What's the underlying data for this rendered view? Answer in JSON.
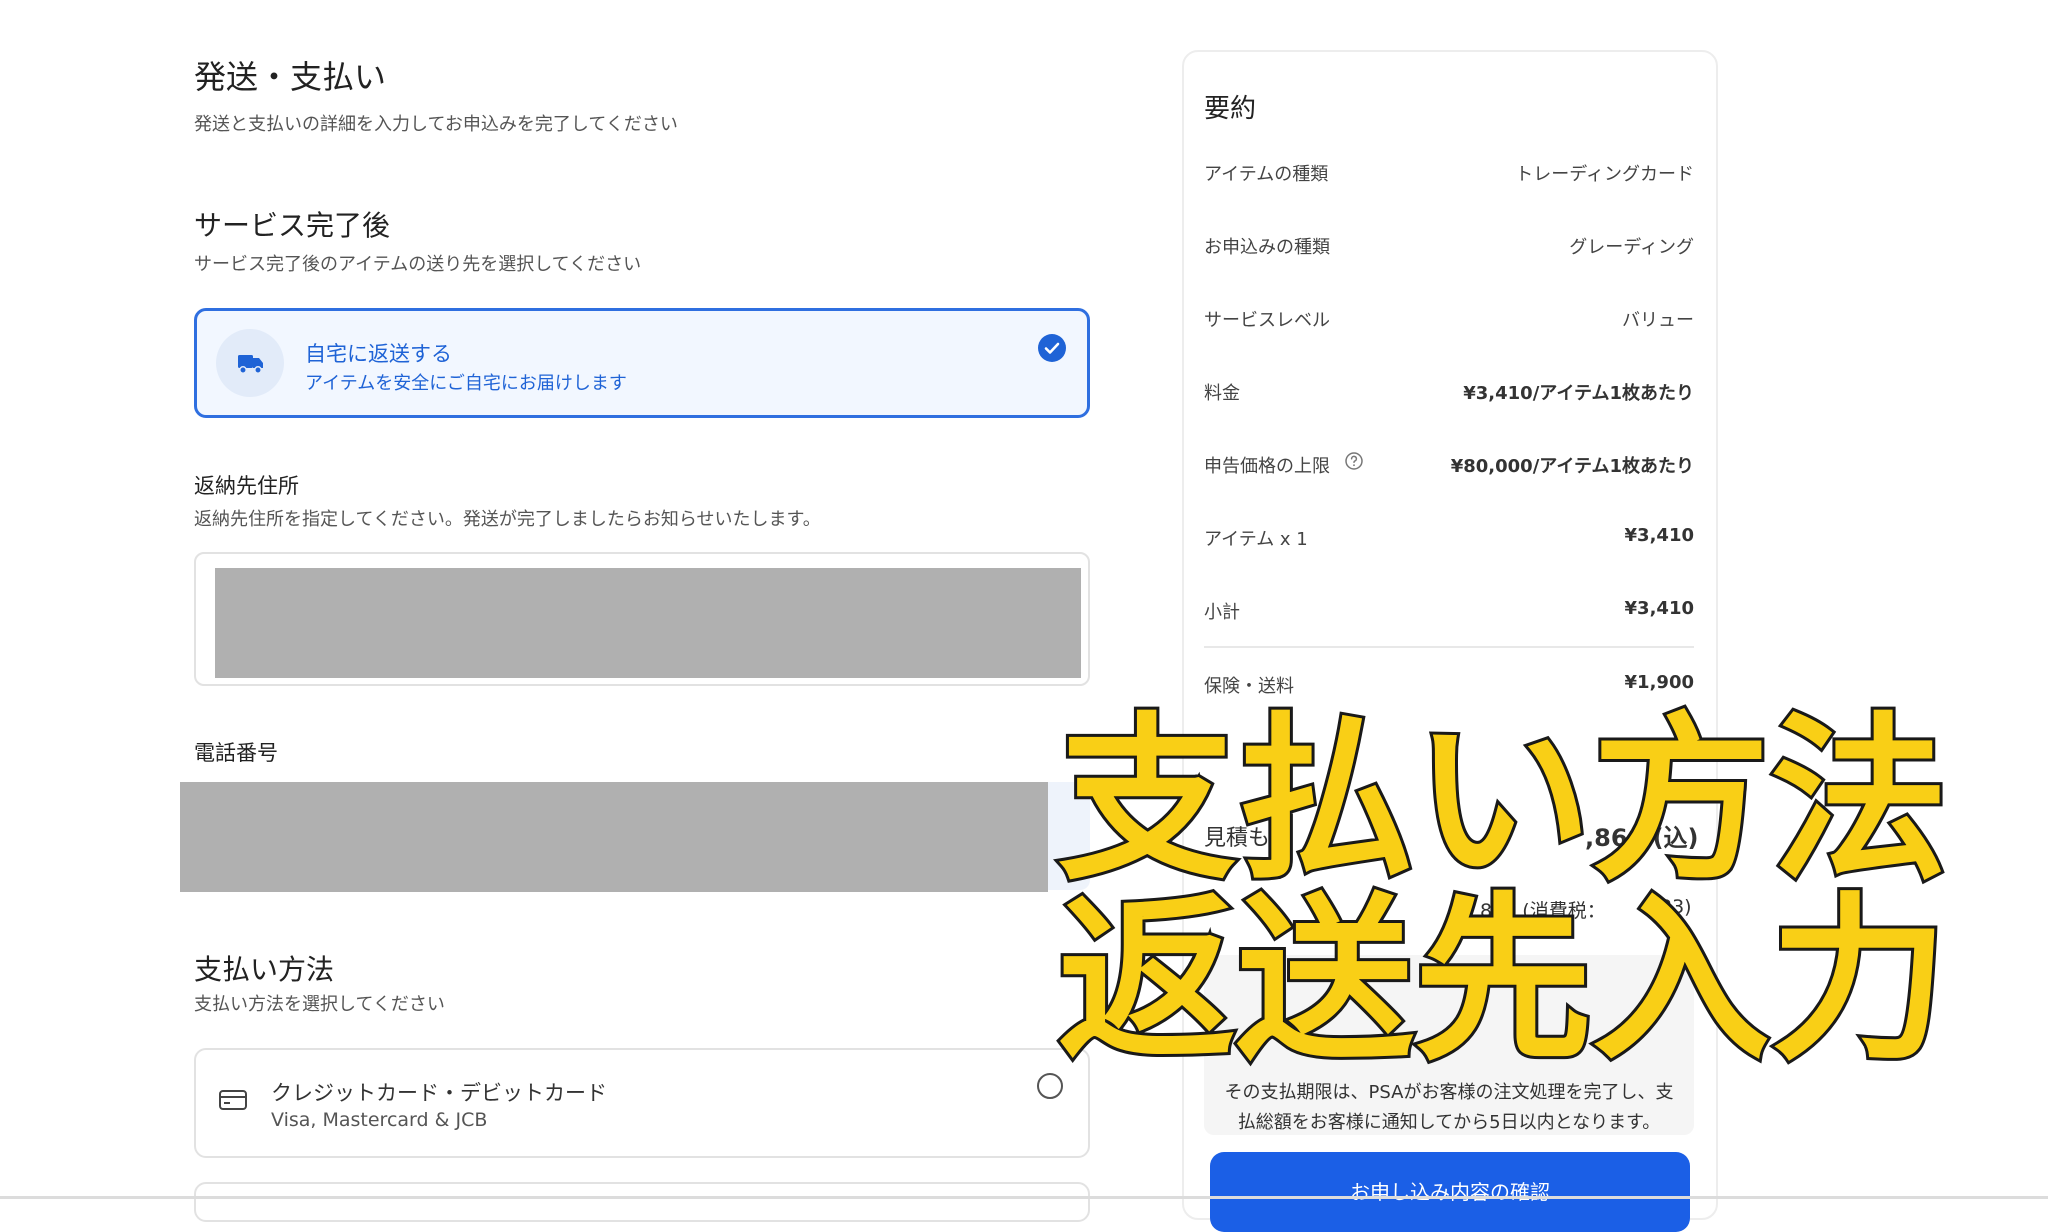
{
  "page": {
    "title": "発送・支払い",
    "subtitle": "発送と支払いの詳細を入力してお申込みを完了してください"
  },
  "after_service": {
    "heading": "サービス完了後",
    "subheading": "サービス完了後のアイテムの送り先を選択してください",
    "option": {
      "title": "自宅に返送する",
      "subtitle": "アイテムを安全にご自宅にお届けします",
      "icon": "truck-icon",
      "selected": true
    }
  },
  "return_address": {
    "heading": "返納先住所",
    "subheading": "返納先住所を指定してください。発送が完了しましたらお知らせいたします。"
  },
  "phone": {
    "heading": "電話番号"
  },
  "payment": {
    "heading": "支払い方法",
    "subheading": "支払い方法を選択してください",
    "option": {
      "title": "クレジットカード・デビットカード",
      "subtitle": "Visa, Mastercard & JCB",
      "icon": "credit-card-icon",
      "selected": false
    }
  },
  "summary": {
    "heading": "要約",
    "rows": [
      {
        "label": "アイテムの種類",
        "value": "トレーディングカード"
      },
      {
        "label": "お申込みの種類",
        "value": "グレーディング"
      },
      {
        "label": "サービスレベル",
        "value": "バリュー"
      },
      {
        "label": "料金",
        "value": "¥3,410/アイテム1枚あたり"
      },
      {
        "label": "申告価格の上限",
        "value": "¥80,000/アイテム1枚あたり"
      },
      {
        "label": "アイテム x 1",
        "value": "¥3,410"
      },
      {
        "label": "小計",
        "value": "¥3,410"
      },
      {
        "label": "保険・送料",
        "value": "¥1,900"
      }
    ],
    "estimate_label_fragment": "見積も",
    "estimate_value_fragment": ",860 (込)",
    "tax_value_fragment": "860 (消費税：",
    "tax_value_end": "33)",
    "notice_lines": [
      "その支払期限は、PSAがお客様の注文処理を完了し、支",
      "払総額をお客様に通知してから5日以内となります。"
    ],
    "confirm_button": "お申し込み内容の確認"
  },
  "overlay": {
    "line1": "支払い方法",
    "line2": "返送先入力"
  },
  "colors": {
    "accent": "#1f63d6",
    "overlay_fill": "#f9cf16",
    "overlay_stroke": "#1a1a1a"
  }
}
